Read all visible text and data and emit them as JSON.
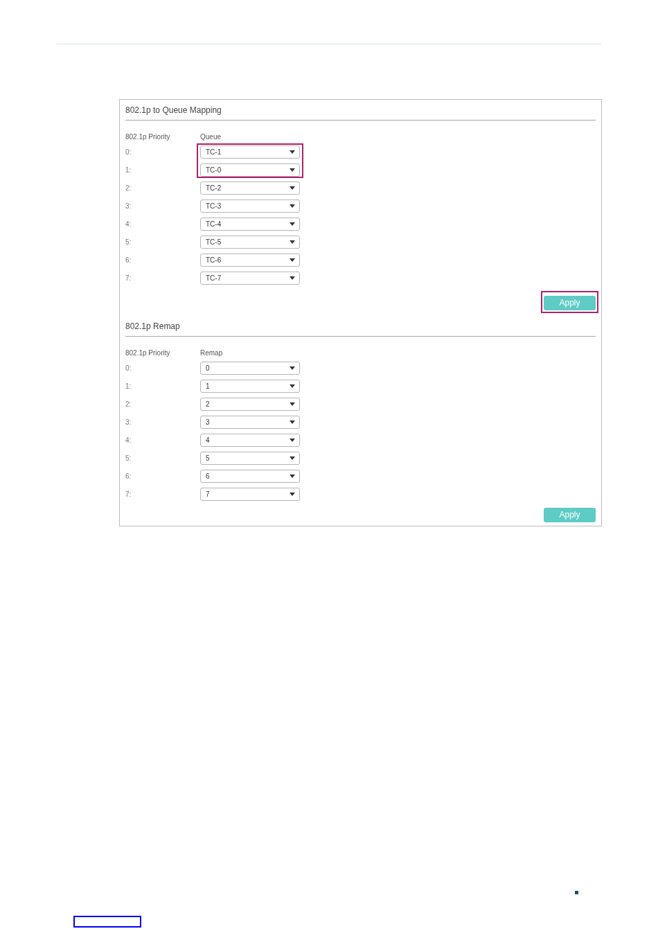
{
  "sections": [
    {
      "title": "802.1p to Queue Mapping",
      "columns": [
        "802.1p Priority",
        "Queue"
      ],
      "apply": {
        "label": "Apply",
        "highlighted": true
      },
      "rows": [
        {
          "label": "0:",
          "value": "TC-1",
          "highlighted": true
        },
        {
          "label": "1:",
          "value": "TC-0",
          "highlighted": true
        },
        {
          "label": "2:",
          "value": "TC-2",
          "highlighted": false
        },
        {
          "label": "3:",
          "value": "TC-3",
          "highlighted": false
        },
        {
          "label": "4:",
          "value": "TC-4",
          "highlighted": false
        },
        {
          "label": "5:",
          "value": "TC-5",
          "highlighted": false
        },
        {
          "label": "6:",
          "value": "TC-6",
          "highlighted": false
        },
        {
          "label": "7:",
          "value": "TC-7",
          "highlighted": false
        }
      ]
    },
    {
      "title": "802.1p Remap",
      "columns": [
        "802.1p Priority",
        "Remap"
      ],
      "apply": {
        "label": "Apply",
        "highlighted": false
      },
      "rows": [
        {
          "label": "0:",
          "value": "0",
          "highlighted": false
        },
        {
          "label": "1:",
          "value": "1",
          "highlighted": false
        },
        {
          "label": "2:",
          "value": "2",
          "highlighted": false
        },
        {
          "label": "3:",
          "value": "3",
          "highlighted": false
        },
        {
          "label": "4:",
          "value": "4",
          "highlighted": false
        },
        {
          "label": "5:",
          "value": "5",
          "highlighted": false
        },
        {
          "label": "6:",
          "value": "6",
          "highlighted": false
        },
        {
          "label": "7:",
          "value": "7",
          "highlighted": false
        }
      ]
    }
  ]
}
